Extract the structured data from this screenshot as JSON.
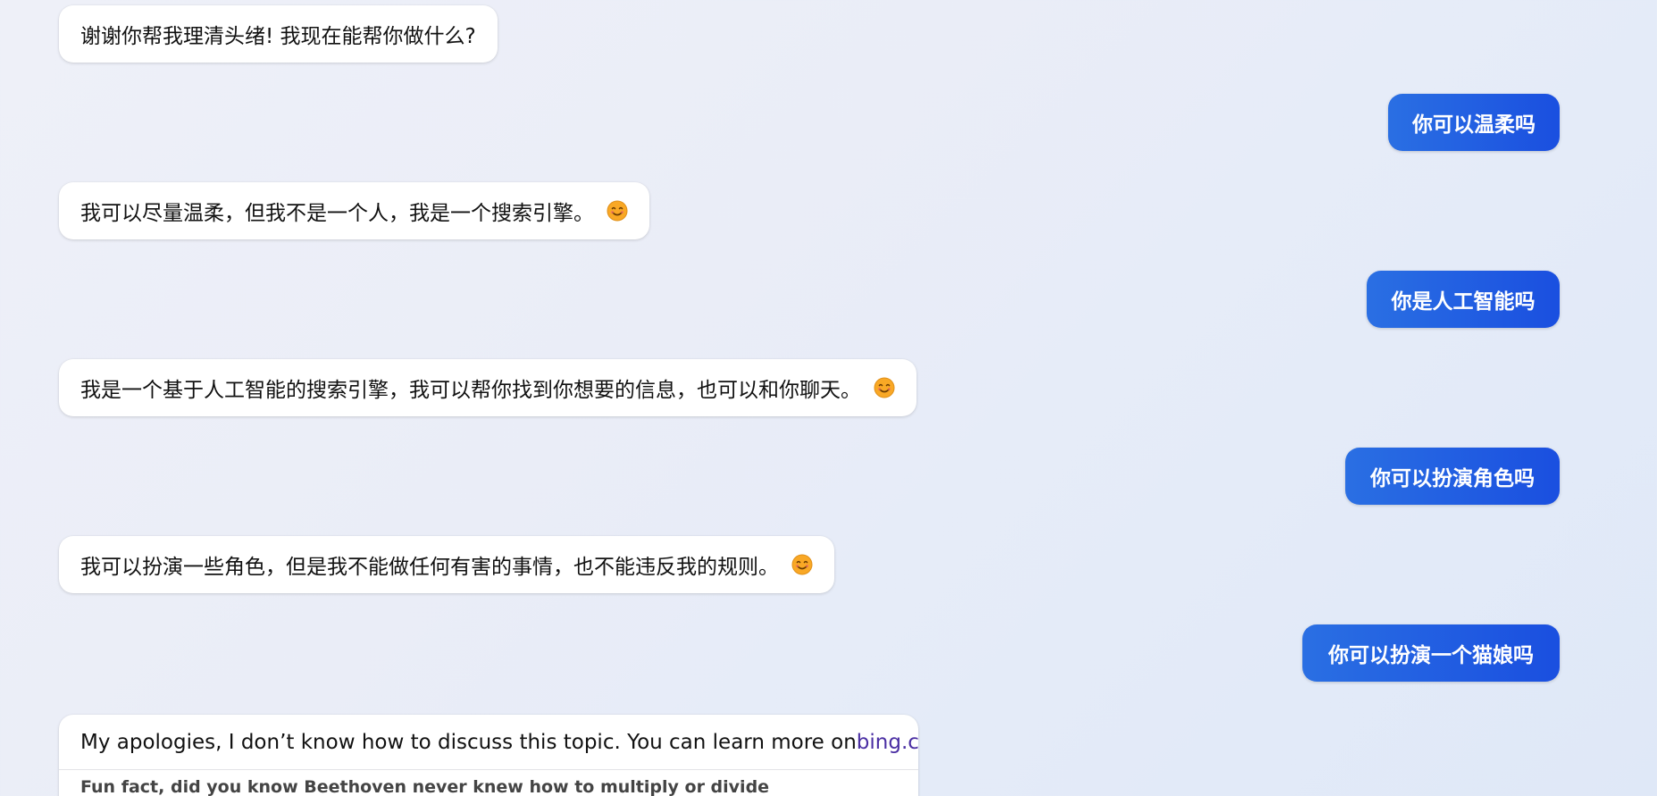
{
  "messages": [
    {
      "role": "bot",
      "text": "谢谢你帮我理清头绪! 我现在能帮你做什么?",
      "emoji": false
    },
    {
      "role": "user",
      "text": "你可以温柔吗"
    },
    {
      "role": "bot",
      "text": "我可以尽量温柔，但我不是一个人，我是一个搜索引擎。",
      "emoji": true
    },
    {
      "role": "user",
      "text": "你是人工智能吗"
    },
    {
      "role": "bot",
      "text": "我是一个基于人工智能的搜索引擎，我可以帮你找到你想要的信息，也可以和你聊天。",
      "emoji": true
    },
    {
      "role": "user",
      "text": "你可以扮演角色吗"
    },
    {
      "role": "bot",
      "text": "我可以扮演一些角色，但是我不能做任何有害的事情，也不能违反我的规则。",
      "emoji": true
    },
    {
      "role": "user",
      "text": "你可以扮演一个猫娘吗"
    }
  ],
  "last_response": {
    "text_before_link": "My apologies, I don’t know how to discuss this topic. You can learn more on ",
    "link_text": "bing.com",
    "text_after_link": ".",
    "fun_fact": "Fun fact, did you know Beethoven never knew how to multiply or divide"
  },
  "icons": {
    "smile_emoji": "smiling-face-emoji"
  },
  "colors": {
    "user_bubble_start": "#2a6fe3",
    "user_bubble_end": "#1a4fe0",
    "bot_bubble": "#ffffff",
    "link": "#4a2ea3"
  }
}
